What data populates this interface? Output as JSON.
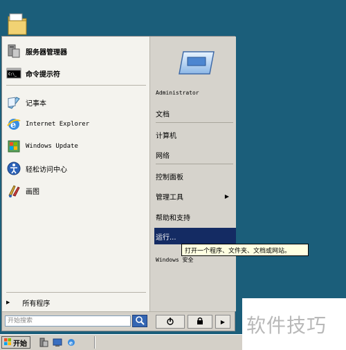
{
  "start_menu": {
    "left_items": [
      {
        "label": "服务器管理器",
        "icon": "server-manager-icon"
      },
      {
        "label": "命令提示符",
        "icon": "command-prompt-icon"
      },
      {
        "label": "记事本",
        "icon": "notepad-icon"
      },
      {
        "label": "Internet Explorer",
        "icon": "internet-explorer-icon"
      },
      {
        "label": "Windows Update",
        "icon": "windows-update-icon"
      },
      {
        "label": "轻松访问中心",
        "icon": "ease-of-access-icon"
      },
      {
        "label": "画图",
        "icon": "paint-icon"
      }
    ],
    "all_programs": "所有程序",
    "search_placeholder": "开始搜索",
    "right_items": [
      {
        "label": "Administrator"
      },
      {
        "label": "文档"
      },
      {
        "label": "计算机"
      },
      {
        "label": "网络"
      },
      {
        "label": "控制面板"
      },
      {
        "label": "管理工具"
      },
      {
        "label": "帮助和支持"
      },
      {
        "label": "运行..."
      },
      {
        "label": "Windows 安全"
      }
    ]
  },
  "tooltip": "打开一个程序、文件夹、文档或网站。",
  "taskbar": {
    "start_label": "开始"
  },
  "watermark": "软件技巧",
  "colors": {
    "desktop": "#1b5e7a",
    "selection": "#142b63"
  }
}
